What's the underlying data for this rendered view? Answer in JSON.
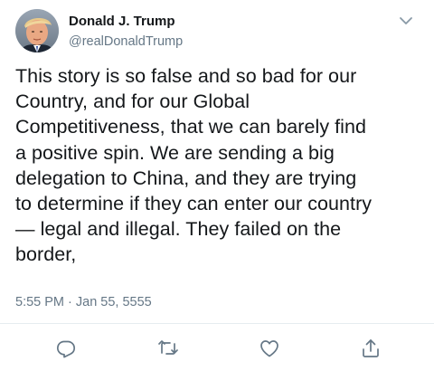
{
  "tweet": {
    "author": {
      "display_name": "Donald J. Trump",
      "handle": "@realDonaldTrump",
      "avatar_icon": "profile-photo"
    },
    "text": "This story is so false and so bad for our\nCountry, and for our Global\nCompetitiveness, that we can barely find\na positive spin. We are sending a big\ndelegation to China, and they are trying\nto determine if they can enter our country\n— legal and illegal. They failed on the\nborder,",
    "timestamp": "5:55 PM · Jan 55, 5555"
  },
  "actions": [
    {
      "name": "reply",
      "icon": "reply-icon"
    },
    {
      "name": "retweet",
      "icon": "retweet-icon"
    },
    {
      "name": "like",
      "icon": "heart-icon"
    },
    {
      "name": "share",
      "icon": "share-icon"
    }
  ],
  "colors": {
    "text_primary": "#14171a",
    "text_secondary": "#657786",
    "divider": "#e6ecf0",
    "icon": "#657786"
  }
}
